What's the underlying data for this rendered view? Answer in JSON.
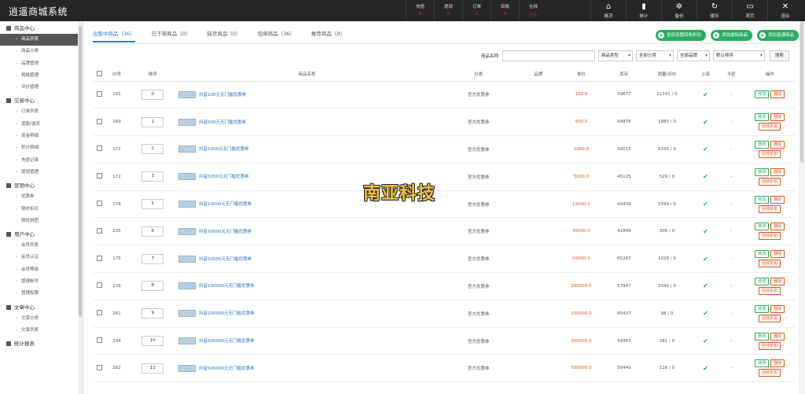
{
  "app": {
    "title": "逍遥商城系统"
  },
  "stats": [
    {
      "label": "充值",
      "value": "0"
    },
    {
      "label": "提现",
      "value": "0"
    },
    {
      "label": "订单",
      "value": "1"
    },
    {
      "label": "回收",
      "value": "0"
    },
    {
      "label": "在线",
      "value": "1人"
    }
  ],
  "nav": [
    {
      "label": "概况",
      "icon": "home-icon"
    },
    {
      "label": "统计",
      "icon": "bar-chart-icon"
    },
    {
      "label": "备份",
      "icon": "gear-icon"
    },
    {
      "label": "缓存",
      "icon": "refresh-icon"
    },
    {
      "label": "首页",
      "icon": "monitor-icon"
    },
    {
      "label": "退出",
      "icon": "logout-icon"
    }
  ],
  "sidebar": [
    {
      "title": "商品中心",
      "items": [
        "商品列表",
        "商品分类",
        "品牌管理",
        "规格管理",
        "评价管理"
      ]
    },
    {
      "title": "交易中心",
      "items": [
        "订单列表",
        "退款/退货",
        "资金明细",
        "积分明细",
        "充值记录",
        "提现管理"
      ]
    },
    {
      "title": "营销中心",
      "items": [
        "优惠券",
        "限时折扣",
        "限时拼团"
      ]
    },
    {
      "title": "用户中心",
      "items": [
        "会员列表",
        "会员认证",
        "会员等级",
        "管理帐号",
        "管理权限"
      ]
    },
    {
      "title": "文章中心",
      "items": [
        "文章分类",
        "文章列表"
      ]
    },
    {
      "title": "统计报表",
      "items": []
    }
  ],
  "tabs": [
    "出售中商品（36）",
    "已下架商品（0）",
    "缺货商品（0）",
    "包邮商品（36）",
    "推荐商品（0）"
  ],
  "actions": [
    "全部设置回收折扣",
    "添加虚拟商品",
    "添加普通商品"
  ],
  "filters": {
    "name_label": "商品名称:",
    "type": "商品类型",
    "category": "全部分类",
    "brand": "全部品牌",
    "sort": "默认排序",
    "search": "搜索"
  },
  "columns": [
    "ID号",
    "排序",
    "商品名称",
    "分类",
    "品牌",
    "单价",
    "库存",
    "销量/评价",
    "上架",
    "卡密",
    "操作"
  ],
  "rows": [
    {
      "id": "191",
      "sort": "0",
      "name": "抖音100元无门槛优惠券",
      "cat": "官方优惠券",
      "price": "100.0",
      "stock": "59677",
      "sales": "11741 / 0",
      "recycle": false
    },
    {
      "id": "169",
      "sort": "1",
      "name": "抖音500元无门槛优惠券",
      "cat": "官方优惠券",
      "price": "500.0",
      "stock": "64876",
      "sales": "1880 / 0",
      "recycle": true
    },
    {
      "id": "171",
      "sort": "2",
      "name": "抖音1000元无门槛优惠券",
      "cat": "官方优惠券",
      "price": "1000.0",
      "stock": "39015",
      "sales": "6330 / 0",
      "recycle": true
    },
    {
      "id": "172",
      "sort": "3",
      "name": "抖音5000元无门槛优惠券",
      "cat": "官方优惠券",
      "price": "5000.0",
      "stock": "45125",
      "sales": "529 / 0",
      "recycle": true
    },
    {
      "id": "174",
      "sort": "5",
      "name": "抖音10000元无门槛优惠券",
      "cat": "官方优惠券",
      "price": "10000.0",
      "stock": "43439",
      "sales": "5599 / 0",
      "recycle": true
    },
    {
      "id": "235",
      "sort": "6",
      "name": "抖音30000元无门槛优惠券",
      "cat": "官方优惠券",
      "price": "30000.0",
      "stock": "41849",
      "sales": "306 / 0",
      "recycle": true
    },
    {
      "id": "175",
      "sort": "7",
      "name": "抖音50000元无门槛优惠券",
      "cat": "官方优惠券",
      "price": "50000.0",
      "stock": "65287",
      "sales": "1028 / 0",
      "recycle": true
    },
    {
      "id": "176",
      "sort": "8",
      "name": "抖音100000元无门槛优惠券",
      "cat": "官方优惠券",
      "price": "100000.0",
      "stock": "57947",
      "sales": "3340 / 0",
      "recycle": true
    },
    {
      "id": "261",
      "sort": "9",
      "name": "抖音200000元无门槛优惠券",
      "cat": "官方优惠券",
      "price": "200000.0",
      "stock": "65437",
      "sales": "98 / 0",
      "recycle": true
    },
    {
      "id": "234",
      "sort": "10",
      "name": "抖音300000元无门槛优惠券",
      "cat": "官方优惠券",
      "price": "300000.0",
      "stock": "54963",
      "sales": "281 / 0",
      "recycle": true
    },
    {
      "id": "262",
      "sort": "11",
      "name": "抖音500000元无门槛优惠券",
      "cat": "官方优惠券",
      "price": "500000.0",
      "stock": "56449",
      "sales": "116 / 0",
      "recycle": true
    }
  ],
  "row_ops": {
    "edit": "修改",
    "delete": "删除",
    "recycle": "回收折扣",
    "dash": "-"
  },
  "watermark": "南亚科技",
  "colors": {
    "accent": "#2a7ee0",
    "green": "#27ae60",
    "orange": "#e2541a"
  }
}
